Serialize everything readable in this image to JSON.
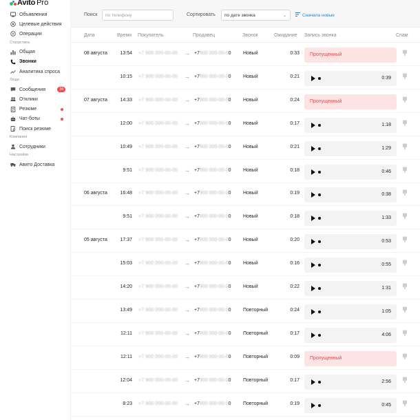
{
  "app": {
    "brand": "Avito",
    "product": "Pro"
  },
  "colors": {
    "accent_blue": "#1a87d7",
    "missed_bg": "#fde3e3",
    "missed_text": "#e34b4b",
    "badge_red": "#f04f4f",
    "logo_green": "#22c55e",
    "logo_blue": "#3b82f6",
    "logo_red": "#ef4444"
  },
  "sidebar": {
    "top_items": [
      {
        "label": "Объявления",
        "icon": "listing-icon"
      },
      {
        "label": "Целевые действия",
        "icon": "target-icon"
      },
      {
        "label": "Операции",
        "icon": "operations-icon"
      }
    ],
    "sections": [
      {
        "title": "Статистика",
        "items": [
          {
            "label": "Общая",
            "icon": "bar-chart-icon",
            "active": false
          },
          {
            "label": "Звонки",
            "icon": "phone-icon",
            "active": true
          },
          {
            "label": "Аналитика спроса",
            "icon": "trend-icon",
            "active": false
          }
        ]
      },
      {
        "title": "Люди",
        "items": [
          {
            "label": "Сообщения",
            "icon": "chat-icon",
            "badge": "34"
          },
          {
            "label": "Отклики",
            "icon": "people-icon"
          },
          {
            "label": "Резюме",
            "icon": "resume-icon",
            "dot": true
          },
          {
            "label": "Чат-боты",
            "icon": "bot-icon",
            "dot": true
          },
          {
            "label": "Поиск резюме",
            "icon": "search-resume-icon"
          }
        ]
      },
      {
        "title": "Компания",
        "items": [
          {
            "label": "Сотрудники",
            "icon": "user-icon"
          }
        ]
      },
      {
        "title": "Настройки",
        "items": [
          {
            "label": "Авито Доставка",
            "icon": "delivery-icon"
          }
        ]
      }
    ]
  },
  "toolbar": {
    "search_label": "Поиск",
    "search_placeholder": "по телефону",
    "sort_label": "Сортировать",
    "sort_value": "по дате звонка",
    "sort_order": "Сначала новые"
  },
  "table": {
    "columns": [
      "Дата",
      "Время",
      "Покупатель",
      "Продавец",
      "Звонок",
      "Ожидание",
      "Запись звонка",
      "Спам"
    ],
    "missed_label": "Пропущенный",
    "rows": [
      {
        "date": "08 августа",
        "time": "13:54",
        "buyer": "+7 900 000-00-00",
        "seller_blur": "900 000-00-0",
        "seller_tail": "0",
        "status": "Новый",
        "wait": "0:33",
        "missed": true,
        "duration": ""
      },
      {
        "date": "",
        "time": "10:15",
        "buyer": "+7 900 000-00-00",
        "seller_blur": "900 000-00-0",
        "seller_tail": "0",
        "status": "Новый",
        "wait": "0:21",
        "missed": false,
        "duration": "0:39"
      },
      {
        "date": "07 августа",
        "time": "14:33",
        "buyer": "+7 900 000-00-00",
        "seller_blur": "900 000-00-0",
        "seller_tail": "0",
        "status": "Новый",
        "wait": "0:24",
        "missed": true,
        "duration": ""
      },
      {
        "date": "",
        "time": "12:00",
        "buyer": "+7 900 000-00-00",
        "seller_blur": "900 000-00-0",
        "seller_tail": "0",
        "status": "Новый",
        "wait": "0:17",
        "missed": false,
        "duration": "1:18"
      },
      {
        "date": "",
        "time": "10:49",
        "buyer": "+7 900 000-00-00",
        "seller_blur": "900 000-00-0",
        "seller_tail": "0",
        "status": "Новый",
        "wait": "0:21",
        "missed": false,
        "duration": "1:29"
      },
      {
        "date": "",
        "time": "9:51",
        "buyer": "+7 900 000-00-00",
        "seller_blur": "900 000-00-0",
        "seller_tail": "0",
        "status": "Новый",
        "wait": "0:18",
        "missed": false,
        "duration": "0:46"
      },
      {
        "date": "06 августа",
        "time": "16:48",
        "buyer": "+7 900 000-00-00",
        "seller_blur": "900 000-00-0",
        "seller_tail": "0",
        "status": "Новый",
        "wait": "0:19",
        "missed": false,
        "duration": "0:38"
      },
      {
        "date": "",
        "time": "9:51",
        "buyer": "+7 900 000-00-00",
        "seller_blur": "900 000-00-0",
        "seller_tail": "0",
        "status": "Новый",
        "wait": "0:18",
        "missed": false,
        "duration": "1:33"
      },
      {
        "date": "05 августа",
        "time": "17:37",
        "buyer": "+7 900 000-00-00",
        "seller_blur": "900 000-00-0",
        "seller_tail": "0",
        "status": "Новый",
        "wait": "0:20",
        "missed": false,
        "duration": "0:53"
      },
      {
        "date": "",
        "time": "15:03",
        "buyer": "+7 900 000-00-00",
        "seller_blur": "900 000-00-0",
        "seller_tail": "0",
        "status": "Новый",
        "wait": "0:16",
        "missed": false,
        "duration": "0:55"
      },
      {
        "date": "",
        "time": "14:20",
        "buyer": "+7 900 000-00-00",
        "seller_blur": "900 000-00-0",
        "seller_tail": "0",
        "status": "Новый",
        "wait": "0:22",
        "missed": false,
        "duration": "1:31"
      },
      {
        "date": "",
        "time": "13:49",
        "buyer": "+7 900 000-00-00",
        "seller_blur": "900 000-00-0",
        "seller_tail": "0",
        "status": "Повторный",
        "wait": "0:24",
        "missed": false,
        "duration": "1:05"
      },
      {
        "date": "",
        "time": "12:11",
        "buyer": "+7 900 000-00-00",
        "seller_blur": "900 000-00-0",
        "seller_tail": "0",
        "status": "Повторный",
        "wait": "0:17",
        "missed": false,
        "duration": "4:06"
      },
      {
        "date": "",
        "time": "12:11",
        "buyer": "+7 900 000-00-00",
        "seller_blur": "900 000-00-0",
        "seller_tail": "0",
        "status": "Повторный",
        "wait": "0:09",
        "missed": true,
        "duration": ""
      },
      {
        "date": "",
        "time": "12:04",
        "buyer": "+7 900 000-00-00",
        "seller_blur": "900 000-00-0",
        "seller_tail": "0",
        "status": "Повторный",
        "wait": "0:17",
        "missed": false,
        "duration": "2:56"
      },
      {
        "date": "",
        "time": "8:23",
        "buyer": "+7 900 000-00-00",
        "seller_blur": "900 000-00-0",
        "seller_tail": "0",
        "status": "Повторный",
        "wait": "0:19",
        "missed": false,
        "duration": "0:45"
      }
    ]
  }
}
